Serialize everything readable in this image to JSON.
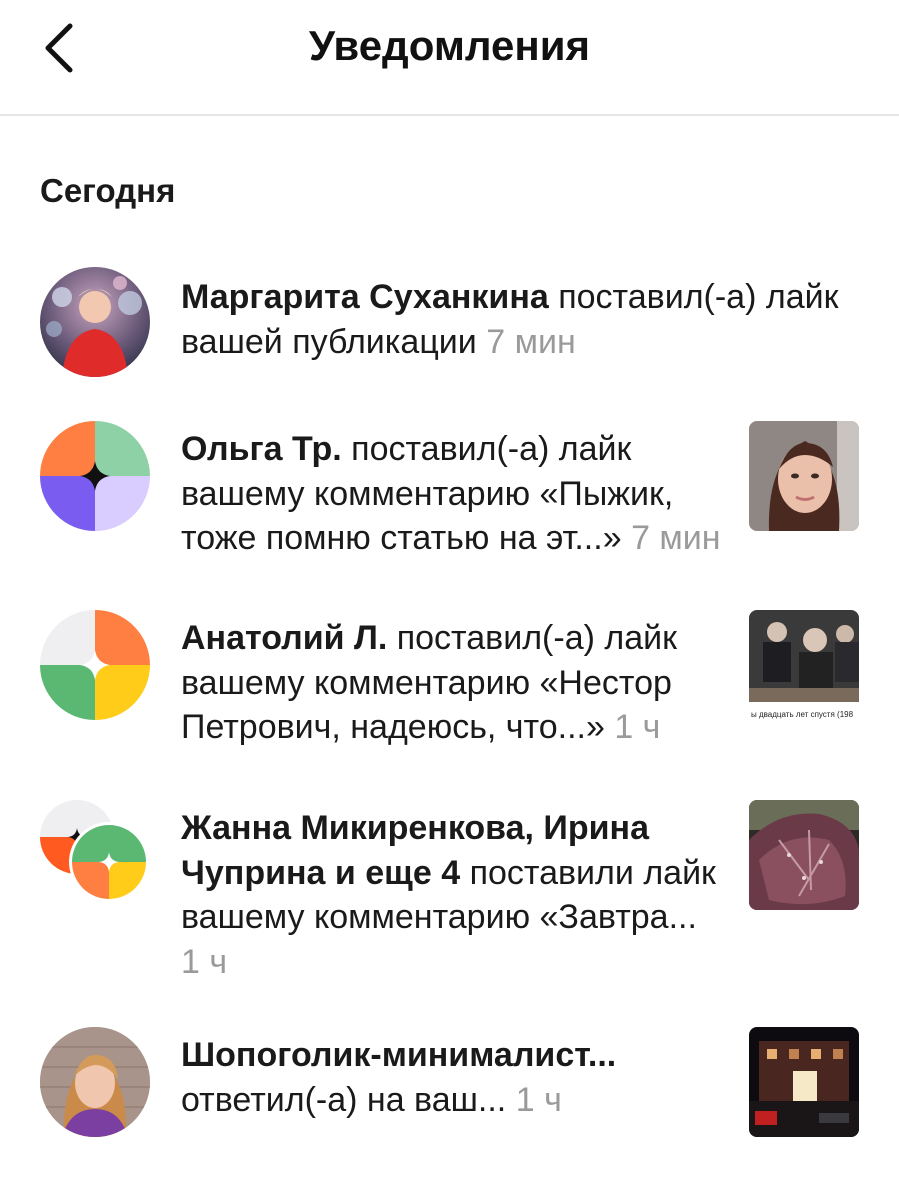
{
  "header": {
    "title": "Уведомления",
    "back_icon": "chevron-left-icon"
  },
  "section": {
    "title": "Сегодня"
  },
  "notifications": [
    {
      "names": "Маргарита Суханкина",
      "action": "поставил(-а) лайк вашей публикации",
      "time": "7 мин"
    },
    {
      "names": "Ольга Тр.",
      "action": "поставил(-а) лайк вашему комментарию «Пыжик, тоже помню статью на эт...»",
      "time": "7 мин"
    },
    {
      "names": "Анатолий Л.",
      "action": "поставил(-а) лайк вашему комментарию «Нестор Петрович, надеюсь, что...»",
      "time": "1 ч",
      "thumb_caption": "ы двадцать лет спустя (198"
    },
    {
      "names": "Жанна Микиренкова, Ирина Чуприна и еще 4",
      "action": "поставили лайк вашему комментарию «Завтра...",
      "time": "1 ч"
    },
    {
      "names": "Шопоголик-минималист...",
      "action": "ответил(-а) на ваш...",
      "time": "1 ч"
    }
  ],
  "colors": {
    "accent_orange": "#ff7f42",
    "mint": "#8fd1a6",
    "purple": "#7a5cf0",
    "lavender": "#d9ccff",
    "green": "#5ab873",
    "yellow": "#ffcc1a",
    "light_gray": "#efeff2",
    "divider": "#e6e6e6",
    "time_gray": "#9a9a9a"
  }
}
